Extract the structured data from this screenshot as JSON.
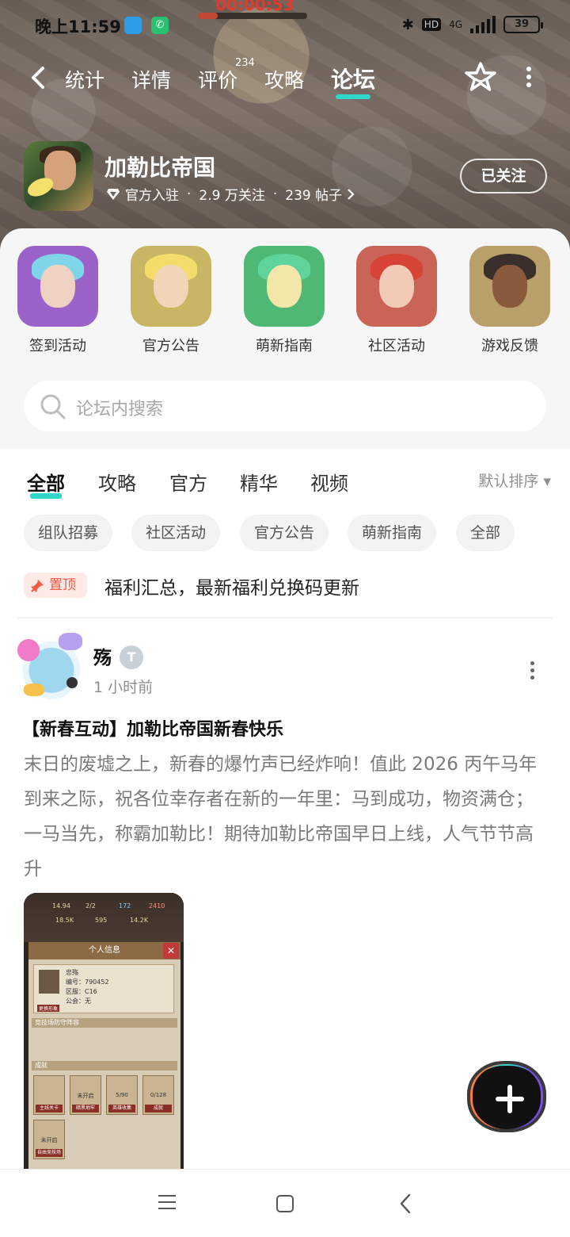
{
  "status_bar": {
    "time": "晚上11:59",
    "timer": "00:00:53",
    "network": "4G",
    "hd": "HD",
    "battery": "39",
    "timer_progress": 0.18
  },
  "nav": {
    "tabs": [
      "统计",
      "详情",
      "评价",
      "攻略",
      "论坛"
    ],
    "active_tab": "论坛",
    "review_count": "234"
  },
  "game": {
    "name": "加勒比帝国",
    "official": "官方入驻",
    "followers": "2.9 万关注",
    "posts": "239 帖子",
    "follow_label": "已关注"
  },
  "categories": [
    {
      "label": "签到活动",
      "bg": "#9b63c9",
      "hair": "#7fd6e8",
      "face": "#f0d2c2"
    },
    {
      "label": "官方公告",
      "bg": "#c9b665",
      "hair": "#f4dc6a",
      "face": "#f0d5b8"
    },
    {
      "label": "萌新指南",
      "bg": "#4fb874",
      "hair": "#5fd49a",
      "face": "#f2e7a8"
    },
    {
      "label": "社区活动",
      "bg": "#c96457",
      "hair": "#d84337",
      "face": "#f1cbb6"
    },
    {
      "label": "游戏反馈",
      "bg": "#b9a06b",
      "hair": "#3a2f2a",
      "face": "#8a5a3c"
    }
  ],
  "search": {
    "placeholder": "论坛内搜索"
  },
  "feed": {
    "tabs": [
      "全部",
      "攻略",
      "官方",
      "精华",
      "视频"
    ],
    "active_tab": "全部",
    "sort": "默认排序 ▾",
    "chips": [
      "组队招募",
      "社区活动",
      "官方公告",
      "萌新指南",
      "全部"
    ],
    "pinned_badge": "置顶",
    "pinned_text": "福利汇总，最新福利兑换码更新"
  },
  "post": {
    "username": "殇",
    "time": "1 小时前",
    "title": "【新春互动】加勒比帝国新春快乐",
    "body": "末日的废墟之上，新春的爆竹声已经炸响！值此 2026 丙午马年到来之际，祝各位幸存者在新的一年里：马到成功，物资满仓；一马当先，称霸加勒比！期待加勒比帝国早日上线，人气节节高升",
    "image": {
      "top_stats": [
        "14.94",
        "2/2",
        "172",
        "18.5K",
        "595",
        "14.2K",
        "2410"
      ],
      "header": "个人信息",
      "name": "忠殇",
      "id_line": "编号：790452",
      "server_line": "区服：C16",
      "guild_line": "公会：无",
      "button": "更换形象",
      "arena": "竞技场防守阵容",
      "achievements": "成就",
      "boxes": [
        "主线关卡",
        "暗黑地牢",
        "英雄收集",
        "成就",
        "自由竞技场"
      ],
      "box_values": [
        "",
        "未开启",
        "5/90",
        "0/128",
        "未开启"
      ]
    }
  }
}
